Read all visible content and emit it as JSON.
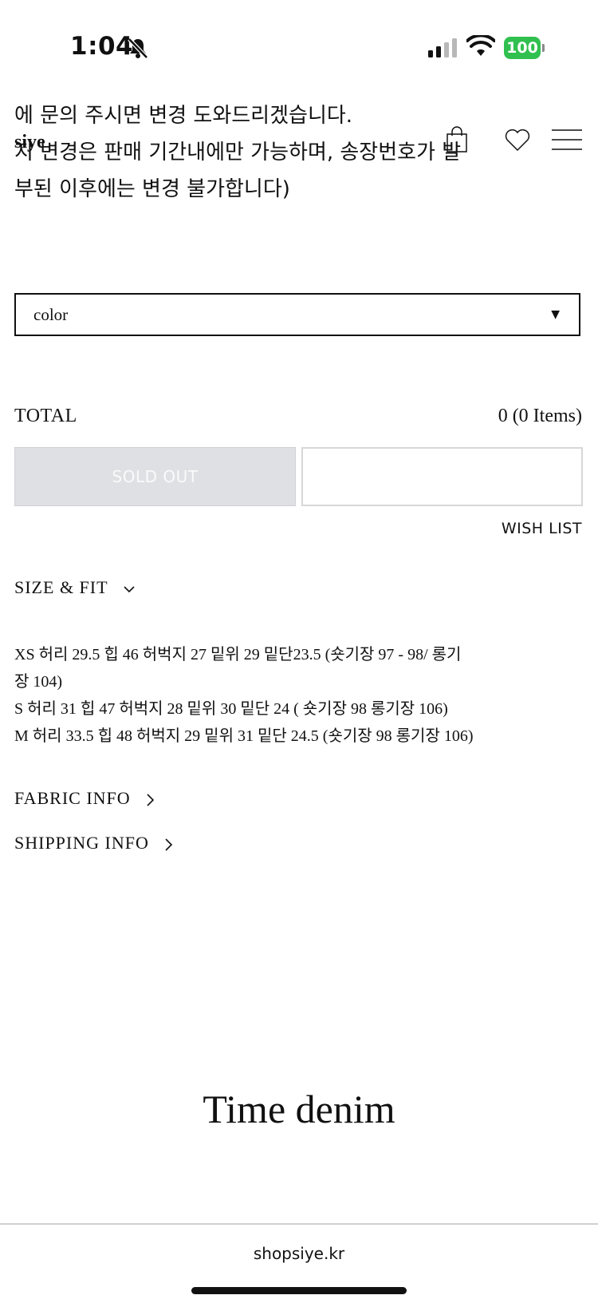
{
  "status_bar": {
    "time": "1:04",
    "battery": "100"
  },
  "header": {
    "logo": "siye"
  },
  "notice": {
    "line1": "에   문의 주시면 변경 도와드리겠습니다.",
    "line2": "     지 변경은 판매 기간내에만 가능하며, 송장번호가 발",
    "line3": "부된 이후에는 변경 불가합니다)"
  },
  "options": {
    "color_placeholder": "color"
  },
  "total": {
    "label": "TOTAL",
    "value": "0 (0 Items)"
  },
  "buttons": {
    "sold_out": "SOLD OUT",
    "wish_list": "WISH LIST"
  },
  "sections": {
    "size_fit": "SIZE & FIT",
    "fabric_info": "FABRIC INFO",
    "shipping_info": "SHIPPING INFO"
  },
  "size_lines": [
    "XS 허리 29.5 힙 46 허벅지 27 밑위 29 밑단23.5    (숏기장 97 - 98/ 롱기",
    "장 104)",
    "S 허리 31 힙 47 허벅지 28 밑위 30 밑단 24     ( 숏기장 98 롱기장 106)",
    "M 허리 33.5 힙 48 허벅지 29 밑위 31 밑단 24.5   (숏기장 98 롱기장 106)"
  ],
  "product": {
    "name": "Time denim"
  },
  "browser": {
    "url": "shopsiye.kr"
  },
  "icons": {
    "bell": "bell-slash-icon",
    "signal": "cellular-signal-icon",
    "wifi": "wifi-icon",
    "battery": "battery-icon",
    "bag": "shopping-bag-icon",
    "heart": "heart-icon",
    "menu": "hamburger-menu-icon",
    "caret": "caret-down-icon",
    "chevron_down": "chevron-down-icon",
    "chevron_right": "chevron-right-icon"
  },
  "colors": {
    "battery": "#30c04f",
    "soldout_bg": "#dfe0e4",
    "text": "#111111"
  }
}
